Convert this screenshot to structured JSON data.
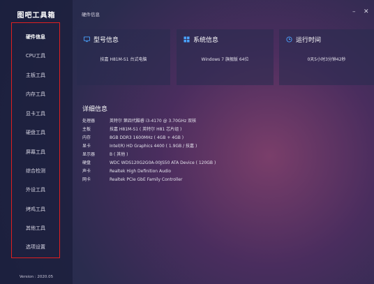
{
  "app": {
    "title": "图吧工具箱",
    "version": "Version : 2020.05"
  },
  "window": {
    "page_label": "硬件信息",
    "minimize": "–",
    "close": "✕"
  },
  "sidebar": {
    "items": [
      {
        "label": "硬件信息",
        "active": true
      },
      {
        "label": "CPU工具"
      },
      {
        "label": "主板工具"
      },
      {
        "label": "内存工具"
      },
      {
        "label": "显卡工具"
      },
      {
        "label": "硬盘工具"
      },
      {
        "label": "屏幕工具"
      },
      {
        "label": "综合检测"
      },
      {
        "label": "外设工具"
      },
      {
        "label": "烤鸡工具"
      },
      {
        "label": "其他工具"
      },
      {
        "label": "选项设置"
      }
    ]
  },
  "cards": [
    {
      "title": "型号信息",
      "icon": "monitor-icon",
      "value": "技嘉 H81M-S1 台式电脑"
    },
    {
      "title": "系统信息",
      "icon": "windows-icon",
      "value": "Windows 7 旗舰版 64位"
    },
    {
      "title": "运行时间",
      "icon": "clock-icon",
      "value": "0天5小时3分钟42秒"
    }
  ],
  "detail": {
    "title": "详细信息",
    "rows": [
      {
        "key": "处理器",
        "value": "英特尔 第四代酷睿 i3-4170 @ 3.70GHz 双核"
      },
      {
        "key": "主板",
        "value": "技嘉 H81M-S1 ( 英特尔 H81 芯片组 )"
      },
      {
        "key": "内存",
        "value": "8GB DDR3 1600MHz ( 4GB + 4GB )"
      },
      {
        "key": "显卡",
        "value": "Intel(R) HD Graphics 4400 ( 1.9GB / 技嘉 )"
      },
      {
        "key": "显示器",
        "value": "B ( 其他 )"
      },
      {
        "key": "硬盘",
        "value": "WDC WDS120G2G0A-00JS50 ATA Device ( 120GB )"
      },
      {
        "key": "声卡",
        "value": "Realtek High Definition Audio"
      },
      {
        "key": "网卡",
        "value": "Realtek PCIe GbE Family Controller"
      }
    ]
  },
  "colors": {
    "highlight_box": "#e02020",
    "accent_icon": "#4aa3ff"
  }
}
